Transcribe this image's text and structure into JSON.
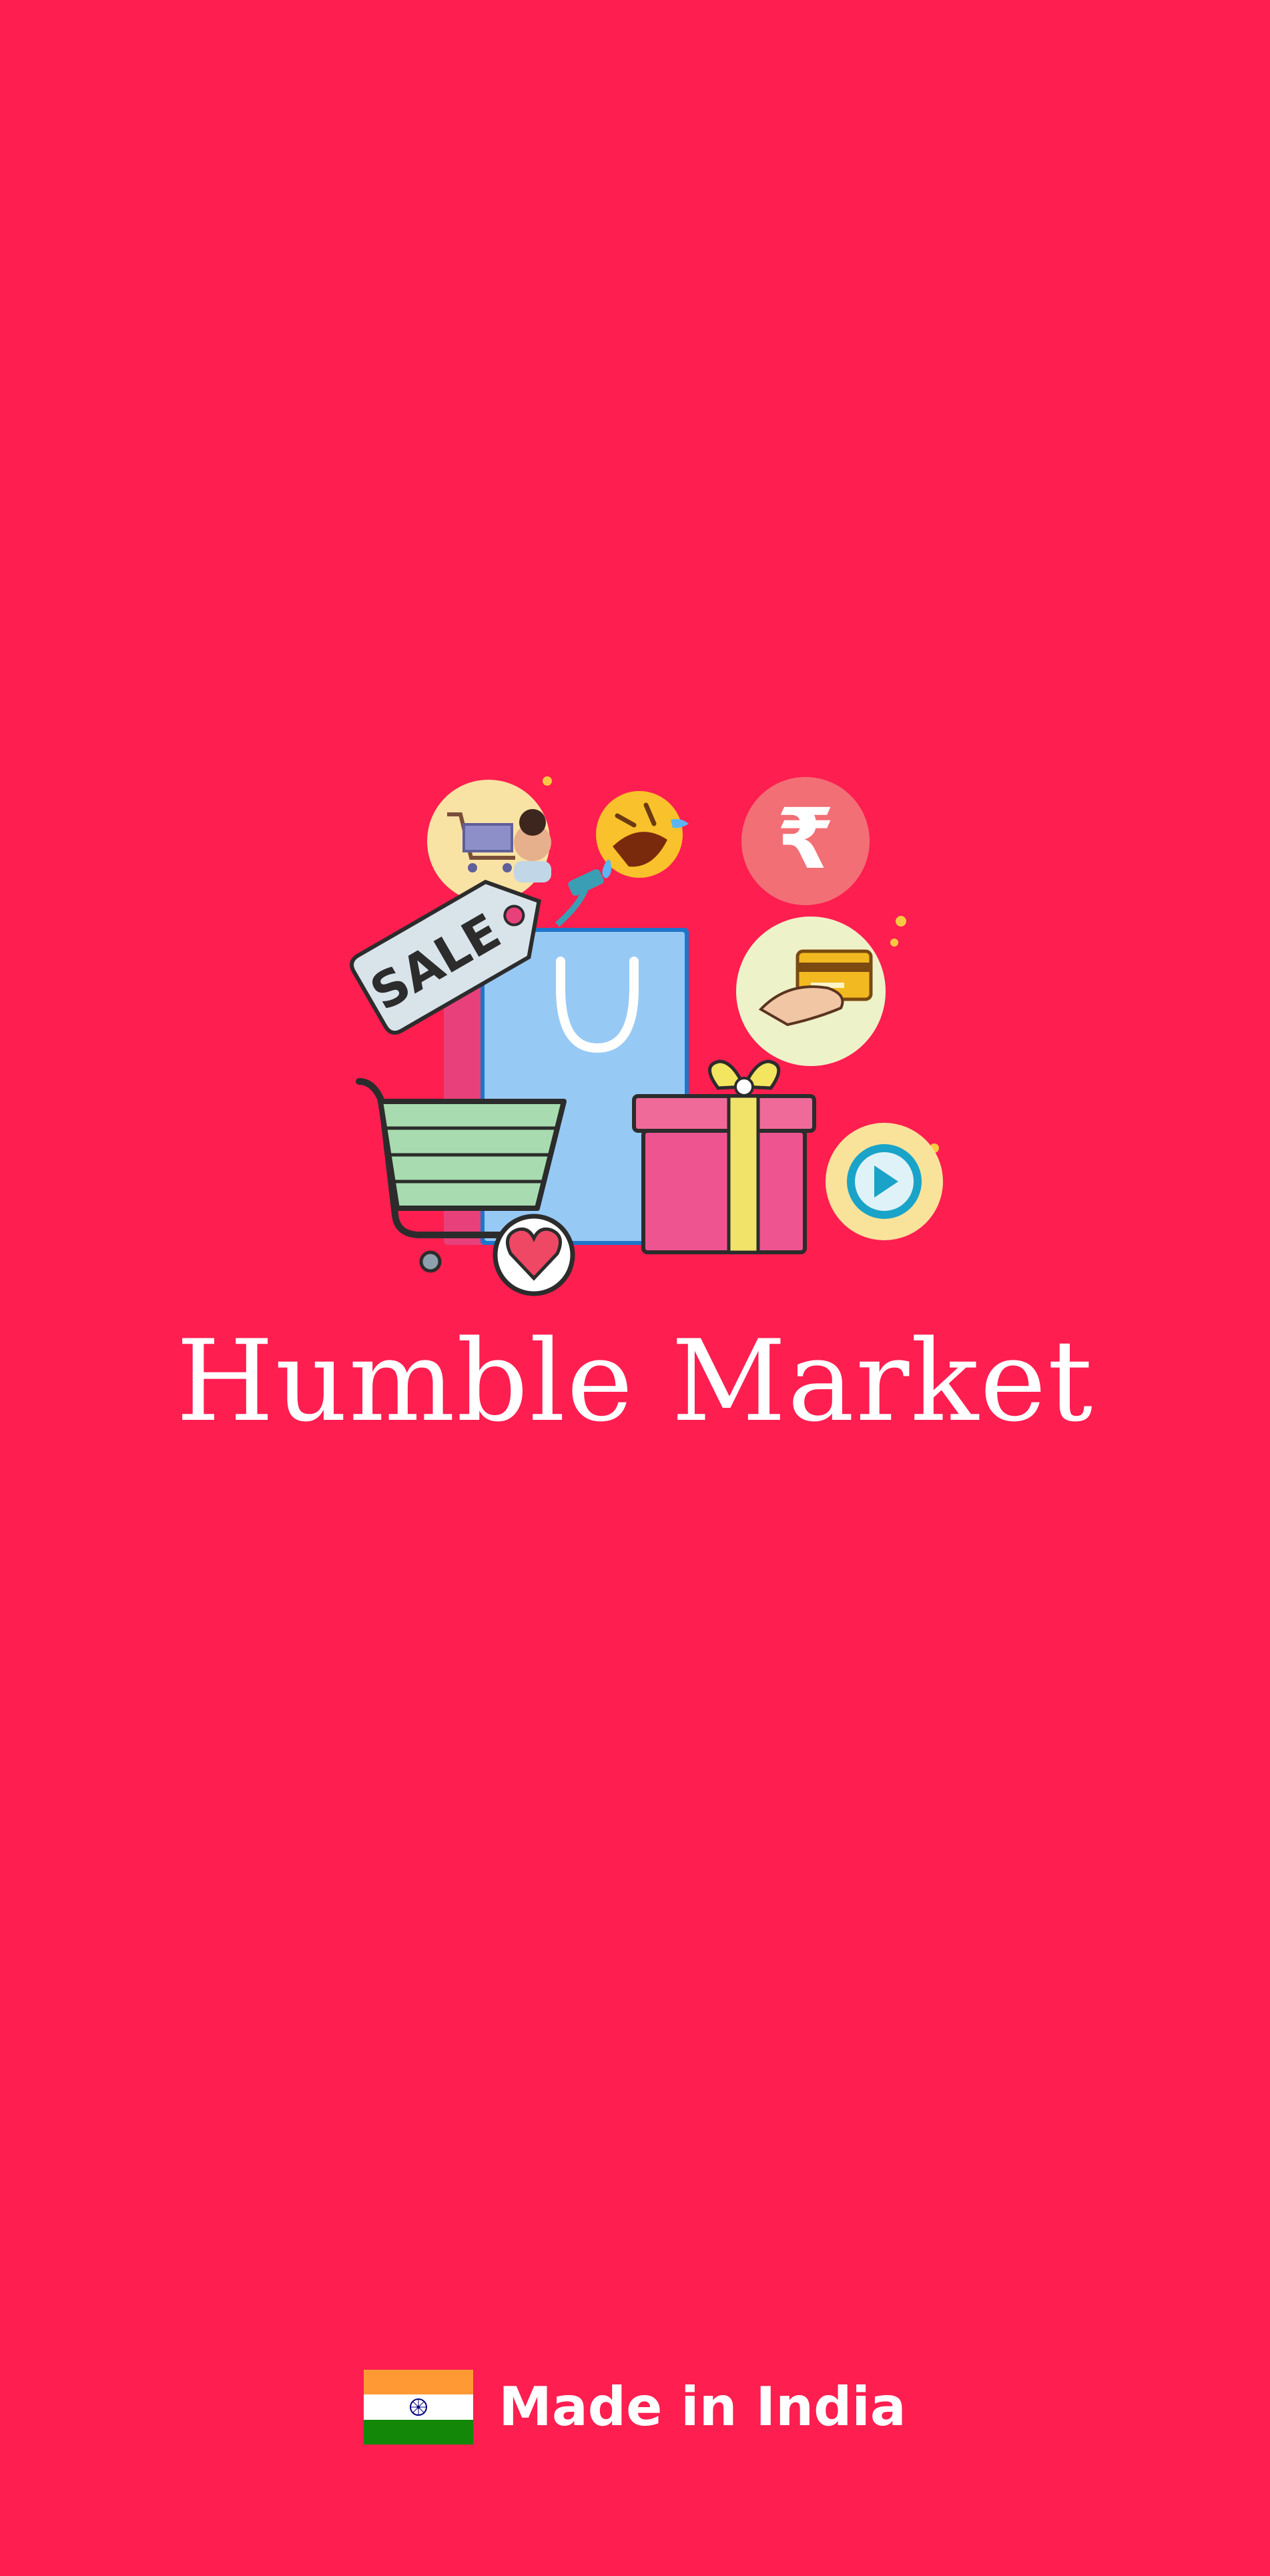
{
  "app": {
    "title": "Humble Market",
    "background_color": "#fe1e50"
  },
  "splash_art": {
    "icons": [
      "shopping-cart-avatar-icon",
      "laughing-emoji-icon",
      "rupee-icon",
      "sale-tag-icon",
      "shopping-bag-icon",
      "credit-card-hand-icon",
      "shopping-cart-icon",
      "heart-icon",
      "gift-box-icon",
      "play-icon"
    ],
    "sale_tag_text": "SALE",
    "rupee_symbol": "₹"
  },
  "footer": {
    "label": "Made in India",
    "flag_icon": "india-flag-icon",
    "flag_colors": {
      "saffron": "#ff9933",
      "white": "#ffffff",
      "green": "#138808",
      "chakra": "#000080"
    }
  }
}
